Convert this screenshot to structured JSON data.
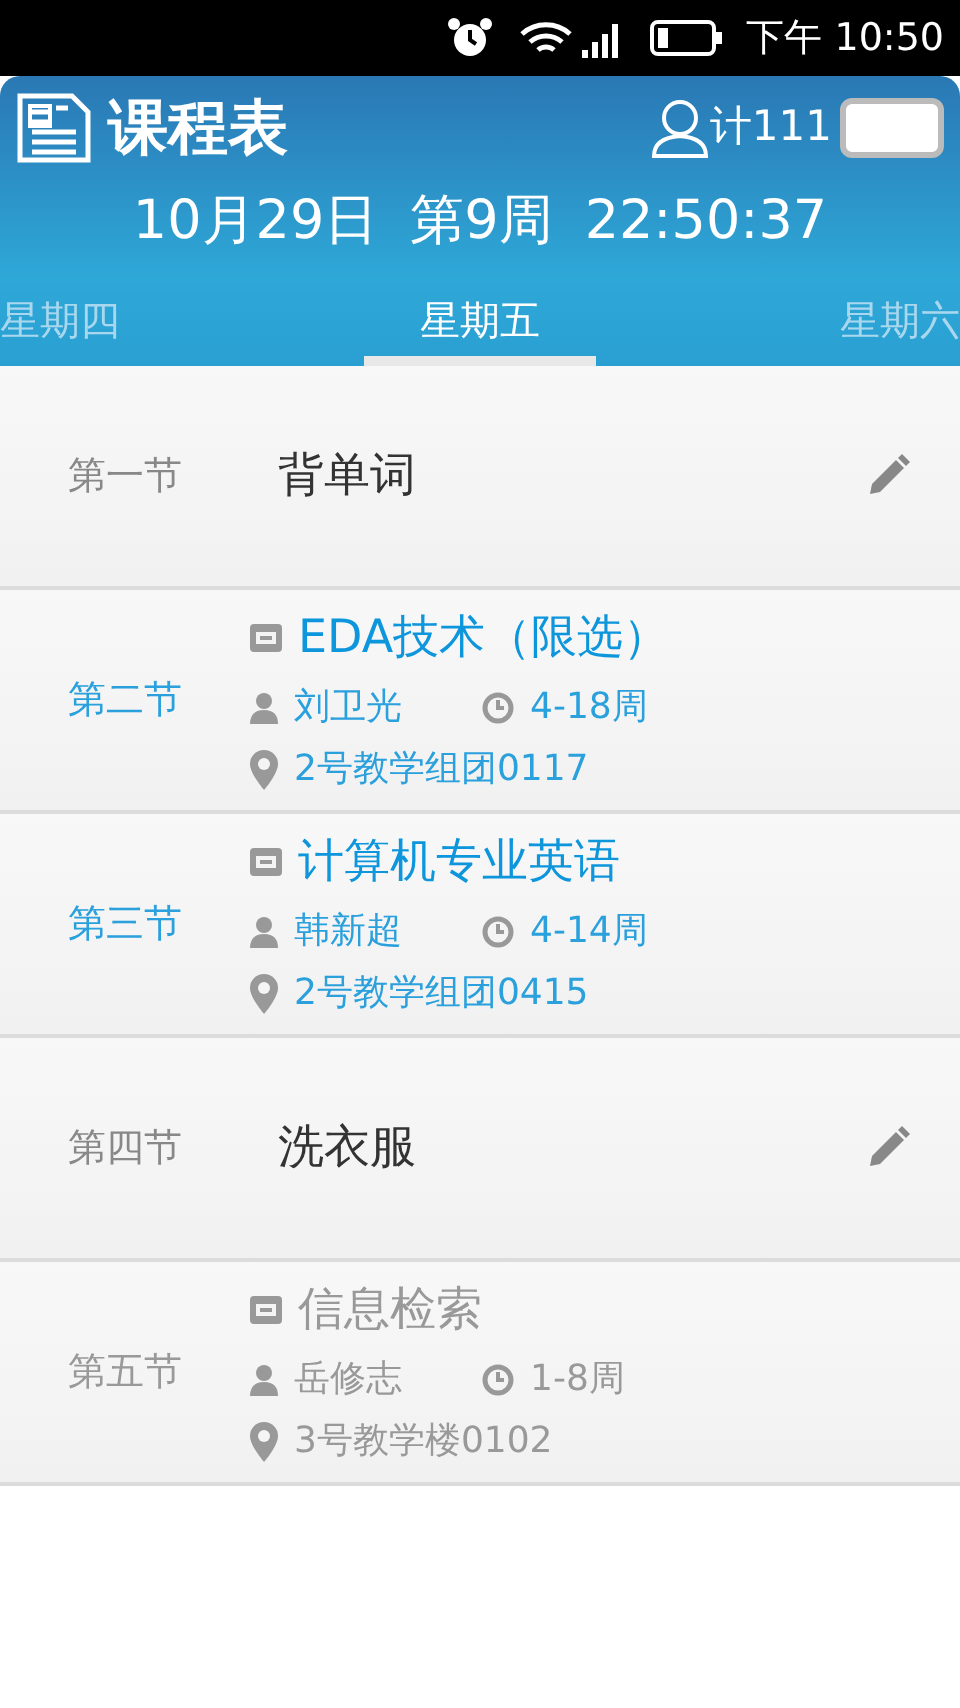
{
  "status_bar": {
    "time": "下午 10:50"
  },
  "header": {
    "title": "课程表",
    "user": "计111",
    "date": "10月29日",
    "week": "第9周",
    "clock": "22:50:37"
  },
  "tabs": [
    {
      "label": "星期四",
      "selected": false
    },
    {
      "label": "星期五",
      "selected": true
    },
    {
      "label": "星期六",
      "selected": false
    }
  ],
  "rows": [
    {
      "kind": "note",
      "period": "第一节",
      "text": "背单词"
    },
    {
      "kind": "course",
      "period": "第二节",
      "active": true,
      "name": "EDA技术（限选）",
      "teacher": "刘卫光",
      "weeks": "4-18周",
      "room": "2号教学组团0117"
    },
    {
      "kind": "course",
      "period": "第三节",
      "active": true,
      "name": "计算机专业英语",
      "teacher": "韩新超",
      "weeks": "4-14周",
      "room": "2号教学组团0415"
    },
    {
      "kind": "note",
      "period": "第四节",
      "text": "洗衣服"
    },
    {
      "kind": "course",
      "period": "第五节",
      "active": false,
      "name": "信息检索",
      "teacher": "岳修志",
      "weeks": "1-8周",
      "room": "3号教学楼0102"
    }
  ]
}
